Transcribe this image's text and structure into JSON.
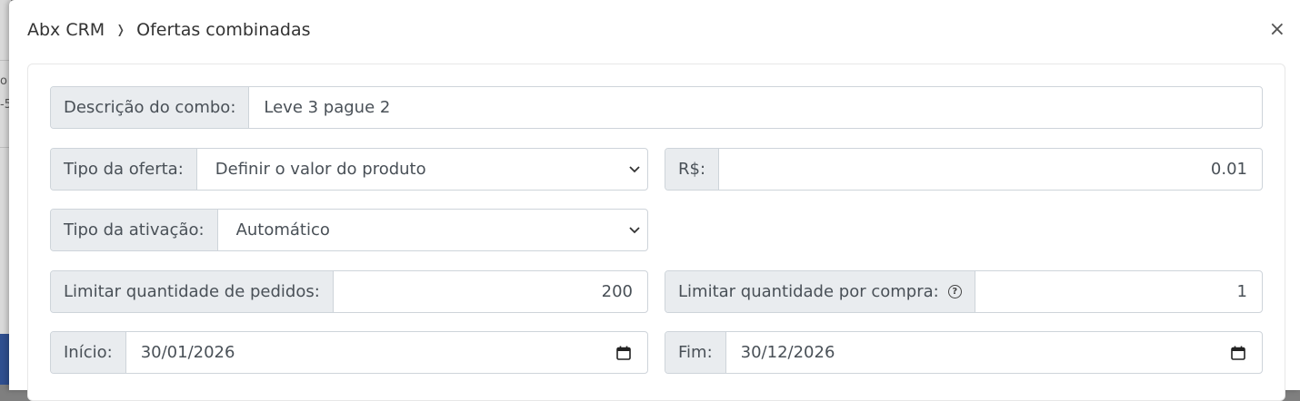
{
  "breadcrumb": {
    "root": "Abx CRM",
    "separator": "❭",
    "current": "Ofertas combinadas"
  },
  "close_label": "×",
  "background": {
    "fragment_1": "o",
    "fragment_2": "-5"
  },
  "form": {
    "descricao": {
      "label": "Descrição do combo:",
      "value": "Leve 3 pague 2"
    },
    "tipo_oferta": {
      "label": "Tipo da oferta:",
      "value": "Definir o valor do produto"
    },
    "valor": {
      "label": "R$:",
      "value": "0.01"
    },
    "tipo_ativacao": {
      "label": "Tipo da ativação:",
      "value": "Automático"
    },
    "limite_pedidos": {
      "label": "Limitar quantidade de pedidos:",
      "value": "200"
    },
    "limite_compra": {
      "label": "Limitar quantidade por compra:",
      "value": "1",
      "help_icon": "?"
    },
    "inicio": {
      "label": "Início:",
      "value": "30/01/2026"
    },
    "fim": {
      "label": "Fim:",
      "value": "30/12/2026"
    }
  },
  "colors": {
    "addon_bg": "#e9ecef",
    "border": "#ced4da",
    "text": "#495057"
  }
}
